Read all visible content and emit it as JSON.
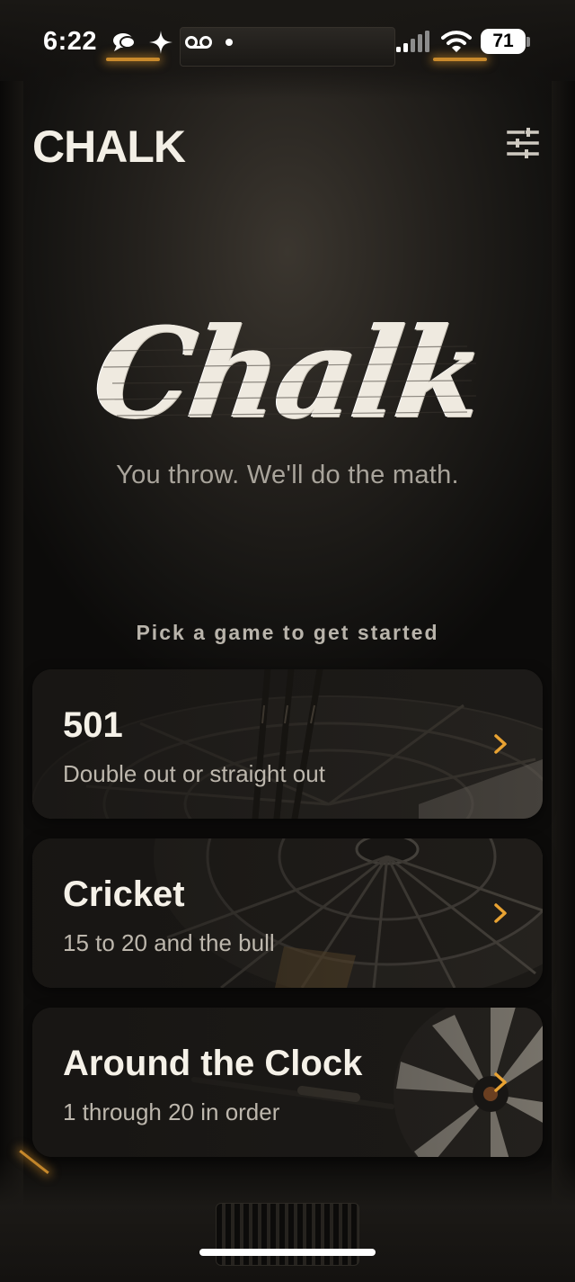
{
  "status_bar": {
    "time": "6:22",
    "battery": "71",
    "icons_left": [
      "message-bubble-icon",
      "sparkle-icon",
      "voicemail-icon",
      "dot-icon"
    ],
    "icons_right": [
      "cellular-signal-icon",
      "wifi-icon",
      "battery-icon"
    ]
  },
  "header": {
    "title": "CHALK",
    "settings_icon": "sliders-icon"
  },
  "hero": {
    "logo_text": "Chalk",
    "tagline": "You throw. We'll do the math."
  },
  "prompt": "Pick a game to get started",
  "games": [
    {
      "title": "501",
      "subtitle": "Double out or straight out",
      "chevron_color": "#e8a232",
      "icon": "chevron-right-icon"
    },
    {
      "title": "Cricket",
      "subtitle": "15 to 20 and the bull",
      "chevron_color": "#e8a232",
      "icon": "chevron-right-icon"
    },
    {
      "title": "Around the Clock",
      "subtitle": "1 through 20 in order",
      "chevron_color": "#e8a232",
      "icon": "chevron-right-icon"
    }
  ],
  "colors": {
    "accent": "#e8a232",
    "background": "#141311",
    "text": "#f3efe6"
  }
}
